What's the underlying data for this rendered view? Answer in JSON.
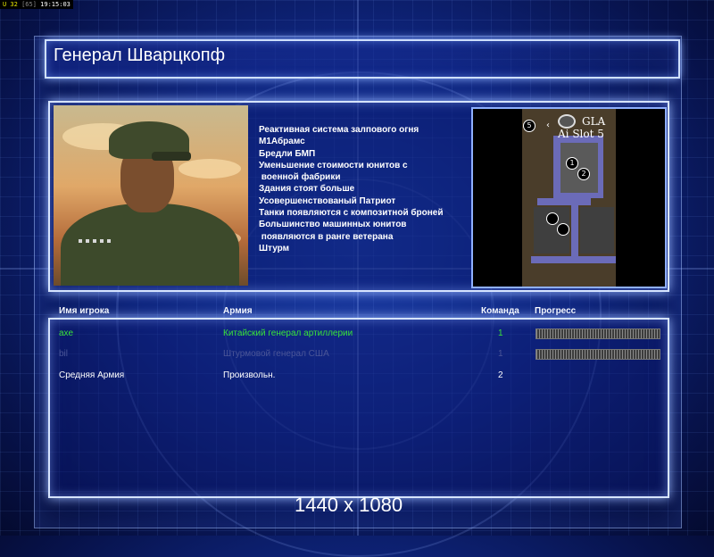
{
  "status": {
    "a": "U 32",
    "b": "[65]",
    "time": "19:15:03"
  },
  "title": "Генерал Шварцкопф",
  "description": [
    "Реактивная система залпового огня",
    "М1Абрамс",
    "Бредли БМП",
    "Уменьшение стоимости юнитов с",
    " военной фабрики",
    "Здания стоят больше",
    "Усовершенствованый Патриот",
    "Танки появляются с композитной броней",
    "Большинство машинных юнитов",
    " появляются в ранге ветерана",
    "Штурм"
  ],
  "minimap": {
    "label_line1": "GLA",
    "label_line2": "Ai Slot 5",
    "markers": [
      "5",
      "1",
      "2"
    ]
  },
  "table": {
    "headers": {
      "name": "Имя игрока",
      "army": "Армия",
      "team": "Команда",
      "progress": "Прогресс"
    },
    "rows": [
      {
        "name": "axe",
        "army": "Китайский генерал артиллерии",
        "team": "1",
        "progress": 1.0
      },
      {
        "name": "bil",
        "army": "Штурмовой генерал США",
        "team": "1",
        "progress": 1.0
      },
      {
        "name": "Средняя Армия",
        "army": "Произвольн.",
        "team": "2"
      }
    ]
  },
  "resolution": "1440 x 1080",
  "colors": {
    "accent": "#d6e4ff",
    "green": "#39e239",
    "dim": "#4b5698"
  }
}
